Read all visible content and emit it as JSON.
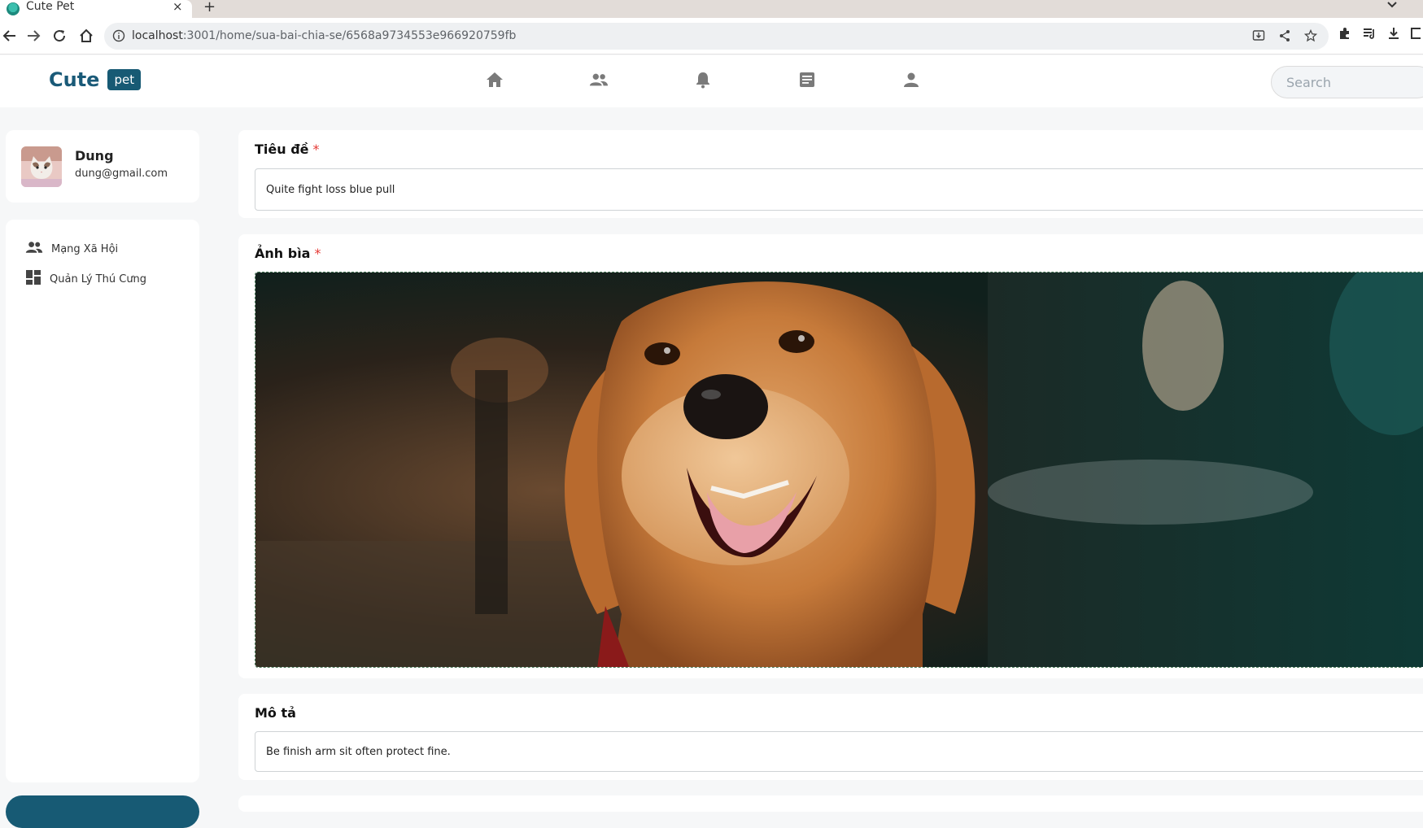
{
  "browser": {
    "tab_title": "Cute Pet",
    "tab_close": "×",
    "new_tab": "+",
    "url_host": "localhost",
    "url_rest": ":3001/home/sua-bai-chia-se/6568a9734553e966920759fb"
  },
  "header": {
    "logo_text": "Cute",
    "logo_badge": "pet",
    "nav_icons": [
      "home-icon",
      "people-icon",
      "bell-icon",
      "article-icon",
      "person-icon"
    ],
    "search_placeholder": "Search"
  },
  "sidebar": {
    "profile_name": "Dung",
    "profile_email": "dung@gmail.com",
    "items": [
      {
        "label": "Mạng Xã Hội",
        "icon": "people-icon"
      },
      {
        "label": "Quản Lý Thú Cưng",
        "icon": "dashboard-icon"
      }
    ]
  },
  "form": {
    "title_label": "Tiêu đề",
    "title_value": "Quite fight loss blue pull",
    "cover_label": "Ảnh bìa",
    "description_label": "Mô tả",
    "description_value": "Be finish arm sit often protect fine.",
    "required_mark": "*"
  },
  "colors": {
    "brand": "#175a74",
    "required": "#e53935",
    "background": "#f6f7f8"
  }
}
